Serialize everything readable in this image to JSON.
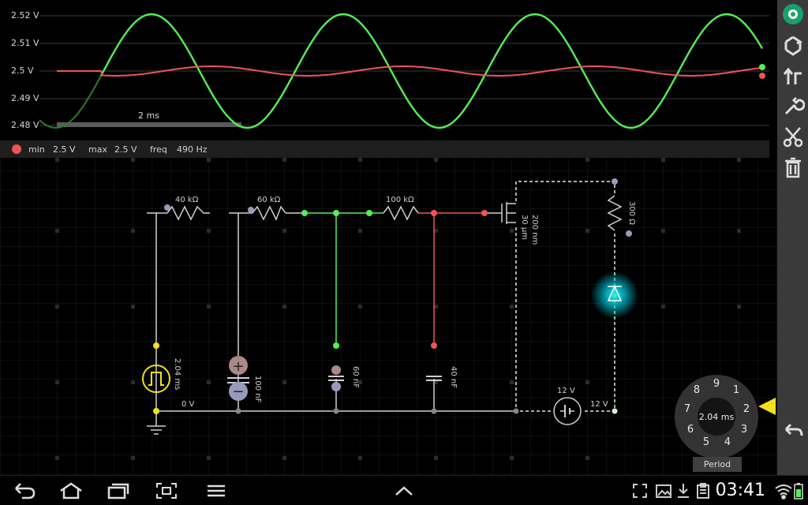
{
  "scope": {
    "y_labels": [
      "2.52 V",
      "2.51 V",
      "2.5 V",
      "2.49 V",
      "2.48 V"
    ],
    "scale_label": "2 ms",
    "info": {
      "min_label": "min",
      "min_value": "2.5 V",
      "max_label": "max",
      "max_value": "2.5 V",
      "freq_label": "freq",
      "freq_value": "490 Hz"
    },
    "colors": {
      "green": "#55ee55",
      "red": "#ee5555"
    }
  },
  "circuit": {
    "r1": "40 kΩ",
    "r2": "60 kΩ",
    "r3": "100 kΩ",
    "r4": "300 Ω",
    "mosfet_w": "30 μm",
    "mosfet_l": "200 nm",
    "source_period": "2.04 ms",
    "source_low": "0 V",
    "c1": "100 nF",
    "c2": "60 nF",
    "c3": "40 nF",
    "battery1": "12 V",
    "battery2": "12 V"
  },
  "dial": {
    "numbers": [
      "9",
      "1",
      "2",
      "3",
      "4",
      "5",
      "6",
      "7",
      "8"
    ],
    "value": "2.04 ms",
    "label": "Period"
  },
  "toolbar": [
    "logo-icon",
    "recycle-icon",
    "upload-icon",
    "wrench-icon",
    "scissors-icon",
    "trash-icon",
    "back-icon"
  ],
  "status": {
    "time": "03:41"
  }
}
